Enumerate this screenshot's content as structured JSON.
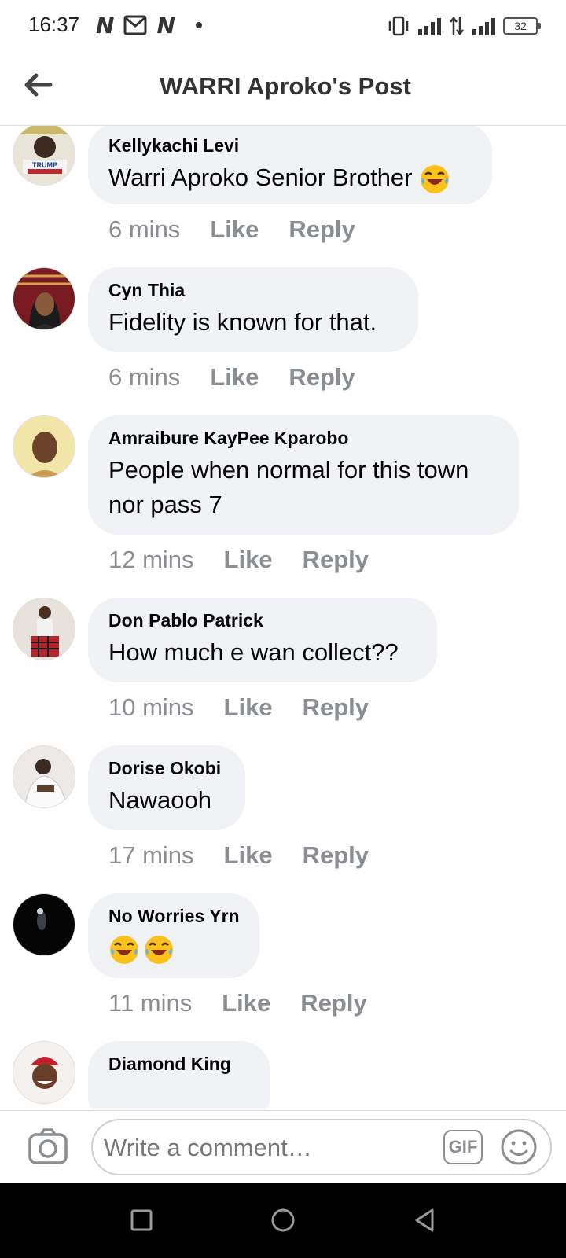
{
  "status_bar": {
    "time": "16:37",
    "battery": "32",
    "left_icons": [
      "n-icon",
      "mail-icon",
      "n-icon"
    ],
    "right_icons": [
      "vibrate-icon",
      "signal-icon",
      "data-arrows-icon",
      "h-plus-signal-icon",
      "battery-icon"
    ]
  },
  "header": {
    "title": "WARRI Aproko's Post"
  },
  "comments": [
    {
      "author": "Kellykachi Levi",
      "text": "Warri Aproko Senior Brother",
      "emoji": "laughing-crying-emoji",
      "time": "6 mins",
      "like": "Like",
      "reply": "Reply"
    },
    {
      "author": "Cyn Thia",
      "text": "Fidelity is known for that.",
      "time": "6 mins",
      "like": "Like",
      "reply": "Reply"
    },
    {
      "author": "Amraibure KayPee Kparobo",
      "text": "People when normal for this town",
      "text2": "nor pass 7",
      "time": "12 mins",
      "like": "Like",
      "reply": "Reply"
    },
    {
      "author": "Don Pablo Patrick",
      "text": "How much e wan collect??",
      "time": "10 mins",
      "like": "Like",
      "reply": "Reply"
    },
    {
      "author": "Dorise Okobi",
      "text": "Nawaooh",
      "time": "17 mins",
      "like": "Like",
      "reply": "Reply"
    },
    {
      "author": "No Worries Yrn",
      "emoji": "laughing-crying-emoji x2",
      "time": "11 mins",
      "like": "Like",
      "reply": "Reply"
    },
    {
      "author": "Diamond King"
    }
  ],
  "composer": {
    "placeholder": "Write a comment…",
    "gif_label": "GIF"
  },
  "colors": {
    "bubble": "#f0f2f5",
    "meta_text": "#8a8d91",
    "nav_bar": "#000000"
  }
}
